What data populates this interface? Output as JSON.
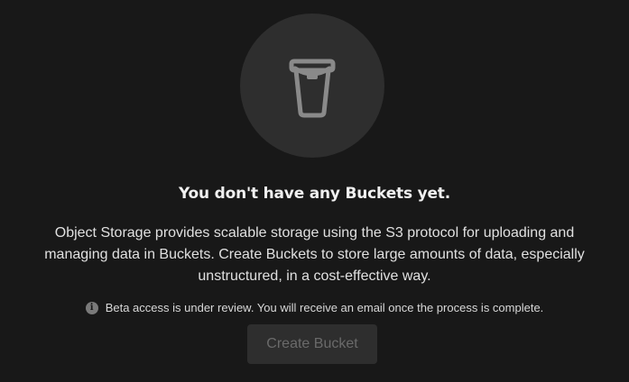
{
  "empty_state": {
    "icon": "bucket-icon",
    "title": "You don't have any Buckets yet.",
    "description": "Object Storage provides scalable storage using the S3 protocol for uploading and managing data in Buckets. Create Buckets to store large amounts of data, especially unstructured, in a cost-effective way.",
    "notice_icon": "info-icon",
    "notice": "Beta access is under review. You will receive an email once the process is complete.",
    "button_label": "Create Bucket",
    "button_disabled": true
  },
  "colors": {
    "background": "#181818",
    "icon_circle": "#2e2e2e",
    "icon_stroke": "#8a8a8a",
    "button_bg": "#2e2e2e",
    "button_text_disabled": "#6a6a6a"
  }
}
